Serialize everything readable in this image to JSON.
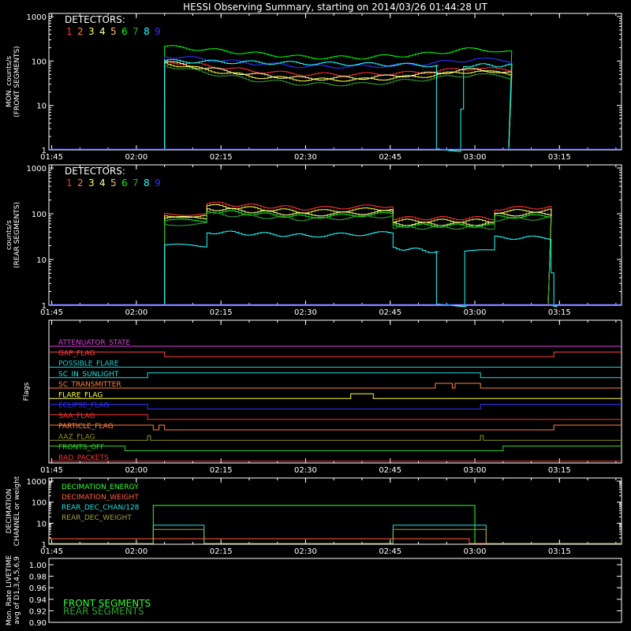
{
  "title": "HESSI Observing Summary, starting on 2014/03/26 01:44:28 UT",
  "time_ticks": [
    "01:45",
    "02:00",
    "02:15",
    "02:30",
    "02:45",
    "03:00",
    "03:15"
  ],
  "colors": {
    "frame": "#ffffff",
    "det": [
      "#ff3030",
      "#ff7f40",
      "#ffff40",
      "#ffffa0",
      "#ffbf60",
      "#00ff00",
      "#30a030",
      "#20ffff",
      "#3030ff"
    ]
  },
  "chart_data": [
    {
      "type": "line",
      "panel": "front",
      "ylabel_lines": [
        "MON. counts/s",
        "(FRONT SEGMENTS)"
      ],
      "ylim": [
        1,
        1000
      ],
      "yscale": "log",
      "yticks": [
        "1",
        "10",
        "100",
        "1000"
      ],
      "legend_title": "DETECTORS:",
      "legend_digits": [
        "1",
        "2",
        "3",
        "4",
        "5",
        "6",
        "7",
        "8",
        "9"
      ],
      "series": [
        {
          "det": 6,
          "x": [
            "02:05",
            "02:10",
            "02:20",
            "02:30",
            "02:40",
            "02:50",
            "03:00",
            "03:06"
          ],
          "y": [
            210,
            190,
            150,
            120,
            120,
            140,
            190,
            160
          ]
        },
        {
          "det": 9,
          "x": [
            "02:05",
            "02:10",
            "02:20",
            "02:30",
            "02:40",
            "02:50",
            "03:00",
            "03:06"
          ],
          "y": [
            130,
            115,
            90,
            75,
            75,
            85,
            110,
            100
          ]
        },
        {
          "det": 1,
          "x": [
            "02:05",
            "02:10",
            "02:20",
            "02:30",
            "02:40",
            "02:50",
            "03:00",
            "03:06"
          ],
          "y": [
            100,
            85,
            60,
            50,
            50,
            55,
            70,
            60
          ]
        },
        {
          "det": 3,
          "x": [
            "02:05",
            "02:10",
            "02:20",
            "02:30",
            "02:40",
            "02:50",
            "03:00",
            "03:06"
          ],
          "y": [
            90,
            70,
            45,
            38,
            38,
            45,
            60,
            50
          ]
        },
        {
          "det": 4,
          "x": [
            "02:05",
            "02:10",
            "02:20",
            "02:30",
            "02:40",
            "02:50",
            "03:00",
            "03:06"
          ],
          "y": [
            95,
            75,
            50,
            40,
            42,
            50,
            65,
            55
          ]
        },
        {
          "det": 7,
          "x": [
            "02:05",
            "02:10",
            "02:20",
            "02:30",
            "02:40",
            "02:50",
            "03:00",
            "03:06"
          ],
          "y": [
            80,
            60,
            38,
            30,
            30,
            38,
            50,
            42
          ]
        },
        {
          "det": 8,
          "x": [
            "02:05",
            "02:53",
            "02:53.2",
            "02:57",
            "02:58",
            "03:06"
          ],
          "y": [
            100,
            80,
            1,
            1,
            80,
            80
          ]
        }
      ]
    },
    {
      "type": "line",
      "panel": "rear",
      "ylabel_lines": [
        "counts/s",
        "(REAR SEGMENTS)"
      ],
      "ylim": [
        1,
        1000
      ],
      "yscale": "log",
      "yticks": [
        "1",
        "10",
        "100",
        "1000"
      ],
      "legend_title": "DETECTORS:",
      "legend_digits": [
        "1",
        "2",
        "3",
        "4",
        "5",
        "6",
        "7",
        "8",
        "9"
      ],
      "series": [
        {
          "det": 1,
          "x": [
            "02:05",
            "02:12",
            "02:12.5",
            "02:30",
            "02:45",
            "02:45.5",
            "03:03",
            "03:03.5",
            "03:13"
          ],
          "y": [
            100,
            100,
            170,
            130,
            150,
            80,
            80,
            130,
            140
          ]
        },
        {
          "det": 3,
          "x": [
            "02:05",
            "02:12",
            "02:12.5",
            "02:30",
            "02:45",
            "02:45.5",
            "03:03",
            "03:03.5",
            "03:13"
          ],
          "y": [
            90,
            90,
            150,
            110,
            130,
            70,
            70,
            110,
            120
          ]
        },
        {
          "det": 4,
          "x": [
            "02:05",
            "02:12",
            "02:12.5",
            "02:30",
            "02:45",
            "02:45.5",
            "03:03",
            "03:03.5",
            "03:13"
          ],
          "y": [
            80,
            80,
            130,
            95,
            110,
            60,
            60,
            95,
            100
          ]
        },
        {
          "det": 6,
          "x": [
            "02:05",
            "02:12",
            "02:12.5",
            "02:30",
            "02:45",
            "02:45.5",
            "03:03",
            "03:03.5",
            "03:13"
          ],
          "y": [
            70,
            70,
            115,
            85,
            100,
            55,
            55,
            85,
            90
          ]
        },
        {
          "det": 7,
          "x": [
            "02:05",
            "02:12",
            "02:12.5",
            "02:30",
            "02:45",
            "02:45.5",
            "03:03",
            "03:03.5",
            "03:13"
          ],
          "y": [
            60,
            60,
            100,
            75,
            90,
            50,
            50,
            75,
            80
          ]
        },
        {
          "det": 8,
          "x": [
            "02:05",
            "02:12",
            "02:12.5",
            "02:30",
            "02:45",
            "02:45.5",
            "02:53",
            "02:53.2",
            "02:58",
            "02:58.2",
            "03:03",
            "03:03.5",
            "03:13",
            "03:14"
          ],
          "y": [
            20,
            20,
            40,
            33,
            38,
            18,
            15,
            1,
            1,
            15,
            15,
            30,
            30,
            1
          ]
        }
      ]
    },
    {
      "type": "step",
      "panel": "flags",
      "ylabel_lines": [
        "Flags"
      ],
      "flags": [
        {
          "name": "ATTENUATOR_STATE",
          "color": "#e040e0",
          "changes": []
        },
        {
          "name": "GAP_FLAG",
          "color": "#ff4040",
          "changes": [
            {
              "x": "02:05",
              "up": false
            },
            {
              "x": "03:14",
              "up": true
            }
          ],
          "start_high": true
        },
        {
          "name": "POSSIBLE_FLARE",
          "color": "#20d0d0",
          "changes": []
        },
        {
          "name": "SC_IN_SUNLIGHT",
          "color": "#20e0e0",
          "changes": [
            {
              "x": "02:02",
              "up": true
            },
            {
              "x": "03:01",
              "up": false
            }
          ]
        },
        {
          "name": "SC_TRANSMITTER",
          "color": "#ff8040",
          "changes": [
            {
              "x": "02:53",
              "up": true
            },
            {
              "x": "02:56",
              "up": false
            },
            {
              "x": "02:56.5",
              "up": true
            },
            {
              "x": "03:01",
              "up": false
            }
          ]
        },
        {
          "name": "FLARE_FLAG",
          "color": "#ffff40",
          "changes": [
            {
              "x": "02:38",
              "up": true
            },
            {
              "x": "02:42",
              "up": false
            }
          ]
        },
        {
          "name": "ECLIPSE_FLAG",
          "color": "#3030ff",
          "changes": [
            {
              "x": "02:02",
              "up": false
            },
            {
              "x": "03:01",
              "up": true
            }
          ],
          "start_high": true
        },
        {
          "name": "SAA_FLAG",
          "color": "#ff3030",
          "changes": [
            {
              "x": "02:02",
              "up": false
            }
          ],
          "start_high": true
        },
        {
          "name": "PARTICLE_FLAG",
          "color": "#ff8040",
          "changes": [
            {
              "x": "02:03",
              "up": false
            },
            {
              "x": "02:04",
              "up": true
            },
            {
              "x": "02:05",
              "up": false
            },
            {
              "x": "03:05",
              "up": false
            },
            {
              "x": "03:14",
              "up": true
            }
          ],
          "start_high": true
        },
        {
          "name": "AAZ_FLAG",
          "color": "#909020",
          "changes": [
            {
              "x": "02:02",
              "up": true
            },
            {
              "x": "02:02.5",
              "up": false
            },
            {
              "x": "03:01",
              "up": true
            },
            {
              "x": "03:01.5",
              "up": false
            }
          ]
        },
        {
          "name": "FRONTS_OFF",
          "color": "#30d030",
          "changes": [
            {
              "x": "01:58",
              "up": false
            },
            {
              "x": "03:05",
              "up": true
            }
          ],
          "start_high": true
        },
        {
          "name": "BAD_PACKETS",
          "color": "#ff3030",
          "changes": []
        }
      ]
    },
    {
      "type": "step",
      "panel": "decimation",
      "ylabel_lines": [
        "DECIMATION",
        "CHANNEL or weight"
      ],
      "ylim": [
        1,
        1000
      ],
      "yscale": "log",
      "yticks": [
        "1",
        "10",
        "100",
        "1000"
      ],
      "series": [
        {
          "name": "DECIMATION_ENERGY",
          "color": "#30ff30",
          "x": [
            "02:03",
            "03:00"
          ],
          "y": [
            70,
            70
          ]
        },
        {
          "name": "DECIMATION_WEIGHT",
          "color": "#ff6040",
          "x": [
            "02:03",
            "02:59",
            "02:59.5"
          ],
          "y": [
            1,
            1,
            1
          ]
        },
        {
          "name": "REAR_DEC_CHAN/128",
          "color": "#20e0e0",
          "x": [
            "02:03",
            "02:12",
            "02:45.5",
            "03:02"
          ],
          "y": [
            8,
            8,
            8,
            8
          ]
        },
        {
          "name": "REAR_DEC_WEIGHT",
          "color": "#a0a040",
          "x": [
            "02:03",
            "02:12",
            "02:45.5",
            "03:02"
          ],
          "y": [
            6,
            6,
            6,
            6
          ]
        }
      ]
    },
    {
      "type": "line",
      "panel": "livetime",
      "ylabel_lines": [
        "Mon. Rate LIVETIME",
        "avg of D1,3,4,5,6,9"
      ],
      "ylim": [
        0.9,
        1.0
      ],
      "yticks": [
        "0.90",
        "0.92",
        "0.94",
        "0.96",
        "0.98",
        "1.00"
      ],
      "series": [
        {
          "name": "FRONT SEGMENTS",
          "color": "#30ff30"
        },
        {
          "name": "REAR SEGMENTS",
          "color": "#30a030"
        }
      ]
    }
  ]
}
